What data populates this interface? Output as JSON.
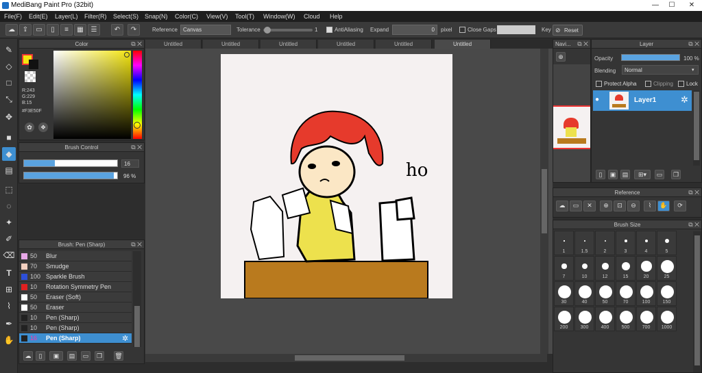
{
  "window": {
    "title": "MediBang Paint Pro (32bit)",
    "minimize": "—",
    "maximize": "☐",
    "close": "✕"
  },
  "menu": [
    "File(F)",
    "Edit(E)",
    "Layer(L)",
    "Filter(R)",
    "Select(S)",
    "Snap(N)",
    "Color(C)",
    "View(V)",
    "Tool(T)",
    "Window(W)",
    "Cloud",
    "Help"
  ],
  "toolbar": {
    "reference_label": "Reference",
    "reference_value": "Canvas",
    "tolerance_label": "Tolerance",
    "tolerance_value": "1",
    "antialiasing_label": "AntiAliasing",
    "expand_label": "Expand",
    "expand_value": "0",
    "pixel_label": "pixel",
    "close_gaps_label": "Close Gaps",
    "key_label": "Key",
    "reset_label": "Reset",
    "tolerance_fraction": 0.02
  },
  "color_panel": {
    "title": "Color",
    "r": "R:243",
    "g": "G:229",
    "b": "B:15",
    "hex": "#F3E50F",
    "fg_color": "#f3e50f"
  },
  "brush_control": {
    "title": "Brush Control",
    "size_value": "16",
    "opacity_value": "96 %",
    "size_fraction": 0.33,
    "opacity_fraction": 0.96
  },
  "brush_panel": {
    "title": "Brush: Pen (Sharp)",
    "items": [
      {
        "size": "50",
        "name": "Blur",
        "color": "#e8a8e8"
      },
      {
        "size": "70",
        "name": "Smudge",
        "color": "#f3d0c0"
      },
      {
        "size": "100",
        "name": "Sparkle Brush",
        "color": "#2d4fd8"
      },
      {
        "size": "10",
        "name": "Rotation Symmetry Pen",
        "color": "#e02020"
      },
      {
        "size": "50",
        "name": "Eraser (Soft)",
        "color": "#ffffff"
      },
      {
        "size": "50",
        "name": "Eraser",
        "color": "#ffffff"
      },
      {
        "size": "10",
        "name": "Pen (Sharp)",
        "color": "#222222"
      },
      {
        "size": "10",
        "name": "Pen (Sharp)",
        "color": "#222222"
      },
      {
        "size": "16",
        "name": "Pen (Sharp)",
        "color": "#222222"
      }
    ]
  },
  "doc_tabs": [
    "Untitled",
    "Untitled",
    "Untitled",
    "Untitled",
    "Untitled",
    "Untitled"
  ],
  "navigator": {
    "title": "Navi..."
  },
  "layer_panel": {
    "title": "Layer",
    "opacity_label": "Opacity",
    "opacity_value": "100 %",
    "blending_label": "Blending",
    "blending_value": "Normal",
    "protect_alpha": "Protect Alpha",
    "clipping": "Clipping",
    "lock": "Lock",
    "layer_name": "Layer1"
  },
  "reference_panel": {
    "title": "Reference"
  },
  "brush_size_panel": {
    "title": "Brush Size",
    "sizes": [
      "1",
      "1.5",
      "2",
      "3",
      "4",
      "5",
      "7",
      "10",
      "12",
      "15",
      "20",
      "25",
      "30",
      "40",
      "50",
      "70",
      "100",
      "150",
      "200",
      "300",
      "400",
      "500",
      "700",
      "1000"
    ]
  },
  "canvas_text": "ho"
}
